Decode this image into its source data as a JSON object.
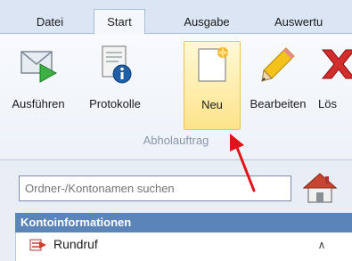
{
  "tabs": [
    {
      "label": "Datei"
    },
    {
      "label": "Start"
    },
    {
      "label": "Ausgabe"
    },
    {
      "label": "Auswertu"
    }
  ],
  "ribbon": {
    "buttons": [
      {
        "label": "Ausführen",
        "icon": "envelope-play-icon"
      },
      {
        "label": "Protokolle",
        "icon": "document-info-icon"
      },
      {
        "label": "Neu",
        "icon": "new-document-icon"
      },
      {
        "label": "Bearbeiten",
        "icon": "pencil-icon"
      },
      {
        "label": "Lös",
        "icon": "delete-x-icon"
      }
    ],
    "group_label": "Abholauftrag"
  },
  "search": {
    "placeholder": "Ordner-/Kontonamen suchen"
  },
  "panel": {
    "section_header": "Kontoinformationen",
    "items": [
      {
        "label": "Rundruf"
      }
    ]
  }
}
